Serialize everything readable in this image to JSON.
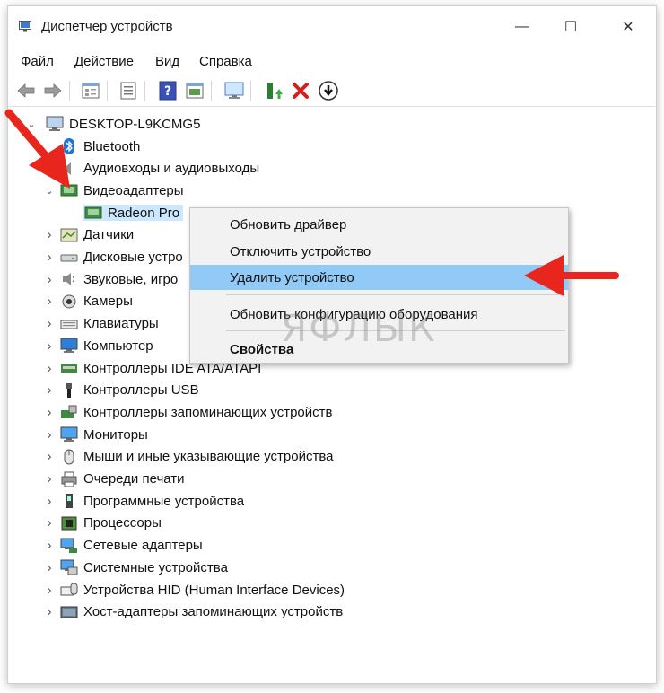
{
  "window": {
    "title": "Диспетчер устройств",
    "controls": {
      "minimize": "—",
      "maximize": "☐",
      "close": "✕"
    }
  },
  "menu": [
    "Файл",
    "Действие",
    "Вид",
    "Справка"
  ],
  "toolbar": [
    "back-arrow-icon",
    "forward-arrow-icon",
    "properties-icon",
    "list-icon",
    "help-icon",
    "view-icon",
    "monitor-icon",
    "update-driver-icon",
    "remove-icon",
    "download-icon"
  ],
  "tree": {
    "root": "DESKTOP-L9KCMG5",
    "items": [
      {
        "label": "Bluetooth",
        "icon": "bluetooth-icon",
        "chevron": ""
      },
      {
        "label": "Аудиовходы и аудиовыходы",
        "icon": "speaker-icon",
        "chevron": ""
      },
      {
        "label": "Видеоадаптеры",
        "icon": "display-adapter-icon",
        "chevron": "open"
      },
      {
        "label": "Radeon Pro",
        "icon": "display-adapter-icon",
        "chevron": "",
        "child": true,
        "selected": true
      },
      {
        "label": "Датчики",
        "icon": "sensor-icon",
        "chevron": "closed"
      },
      {
        "label": "Дисковые устро",
        "icon": "disk-icon",
        "chevron": "closed"
      },
      {
        "label": "Звуковые, игро",
        "icon": "sound-icon",
        "chevron": "closed"
      },
      {
        "label": "Камеры",
        "icon": "camera-icon",
        "chevron": "closed"
      },
      {
        "label": "Клавиатуры",
        "icon": "keyboard-icon",
        "chevron": "closed"
      },
      {
        "label": "Компьютер",
        "icon": "computer-icon",
        "chevron": "closed"
      },
      {
        "label": "Контроллеры IDE ATA/ATAPI",
        "icon": "ide-controller-icon",
        "chevron": "closed"
      },
      {
        "label": "Контроллеры USB",
        "icon": "usb-icon",
        "chevron": "closed"
      },
      {
        "label": "Контроллеры запоминающих устройств",
        "icon": "storage-controller-icon",
        "chevron": "closed"
      },
      {
        "label": "Мониторы",
        "icon": "monitor-icon",
        "chevron": "closed"
      },
      {
        "label": "Мыши и иные указывающие устройства",
        "icon": "mouse-icon",
        "chevron": "closed"
      },
      {
        "label": "Очереди печати",
        "icon": "printer-icon",
        "chevron": "closed"
      },
      {
        "label": "Программные устройства",
        "icon": "software-device-icon",
        "chevron": "closed"
      },
      {
        "label": "Процессоры",
        "icon": "processor-icon",
        "chevron": "closed"
      },
      {
        "label": "Сетевые адаптеры",
        "icon": "network-adapter-icon",
        "chevron": "closed"
      },
      {
        "label": "Системные устройства",
        "icon": "system-device-icon",
        "chevron": "closed"
      },
      {
        "label": "Устройства HID (Human Interface Devices)",
        "icon": "hid-icon",
        "chevron": "closed"
      },
      {
        "label": "Хост-адаптеры запоминающих устройств",
        "icon": "host-adapter-icon",
        "chevron": "closed"
      }
    ]
  },
  "context_menu": {
    "items": [
      {
        "label": "Обновить драйвер"
      },
      {
        "label": "Отключить устройство"
      },
      {
        "label": "Удалить устройство",
        "highlighted": true
      },
      {
        "label": "Обновить конфигурацию оборудования"
      },
      {
        "label": "Свойства",
        "bold": true
      }
    ]
  },
  "watermark": "ЯФЛЫК",
  "colors": {
    "arrow": "#e8261d",
    "highlight": "#91c9f7",
    "selection": "#cce8ff"
  }
}
